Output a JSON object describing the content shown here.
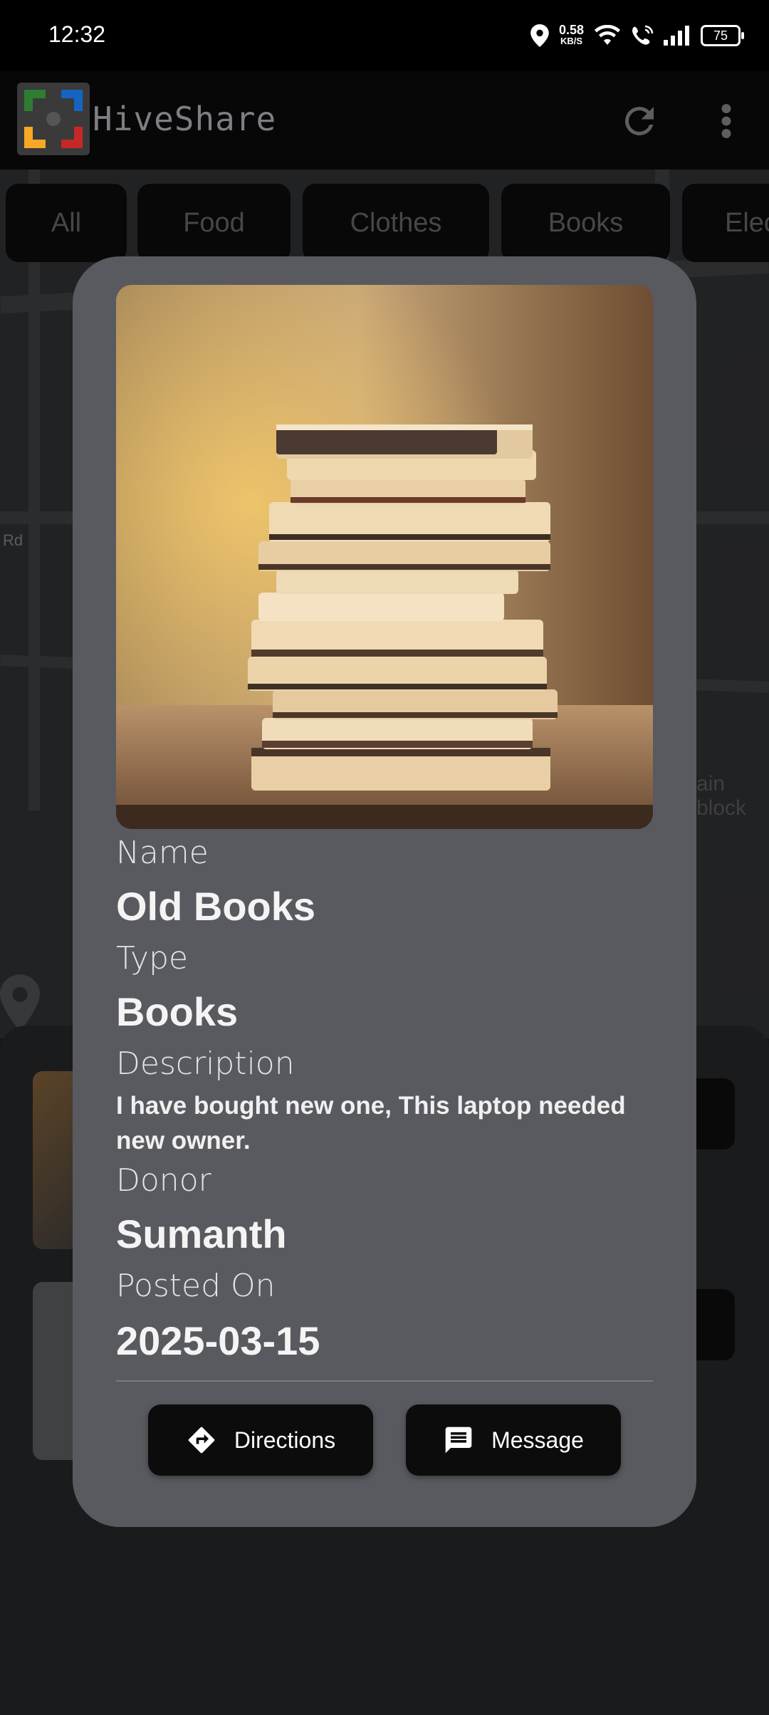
{
  "status_bar": {
    "time": "12:32",
    "net_speed": "0.58",
    "net_unit": "KB/S",
    "battery": "75"
  },
  "app_bar": {
    "title": "HiveShare"
  },
  "categories": [
    "All",
    "Food",
    "Clothes",
    "Books",
    "Elec"
  ],
  "map_labels": [
    "Rd",
    "ain block"
  ],
  "dialog": {
    "name_label": "Name",
    "name_value": "Old Books",
    "type_label": "Type",
    "type_value": "Books",
    "description_label": "Description",
    "description_value": "I have bought new one, This laptop needed new owner.",
    "donor_label": "Donor",
    "donor_value": "Sumanth",
    "posted_label": "Posted On",
    "posted_value": "2025-03-15",
    "directions_label": "Directions",
    "message_label": "Message"
  },
  "colors": {
    "dialog_bg": "#595a5f",
    "button_bg": "#0c0c0d",
    "app_bg": "#1e1f22"
  },
  "icons": [
    "location-icon",
    "wifi-icon",
    "wifi-call-icon",
    "signal-icon",
    "battery-icon",
    "refresh-icon",
    "more-vert-icon",
    "directions-icon",
    "message-icon"
  ]
}
